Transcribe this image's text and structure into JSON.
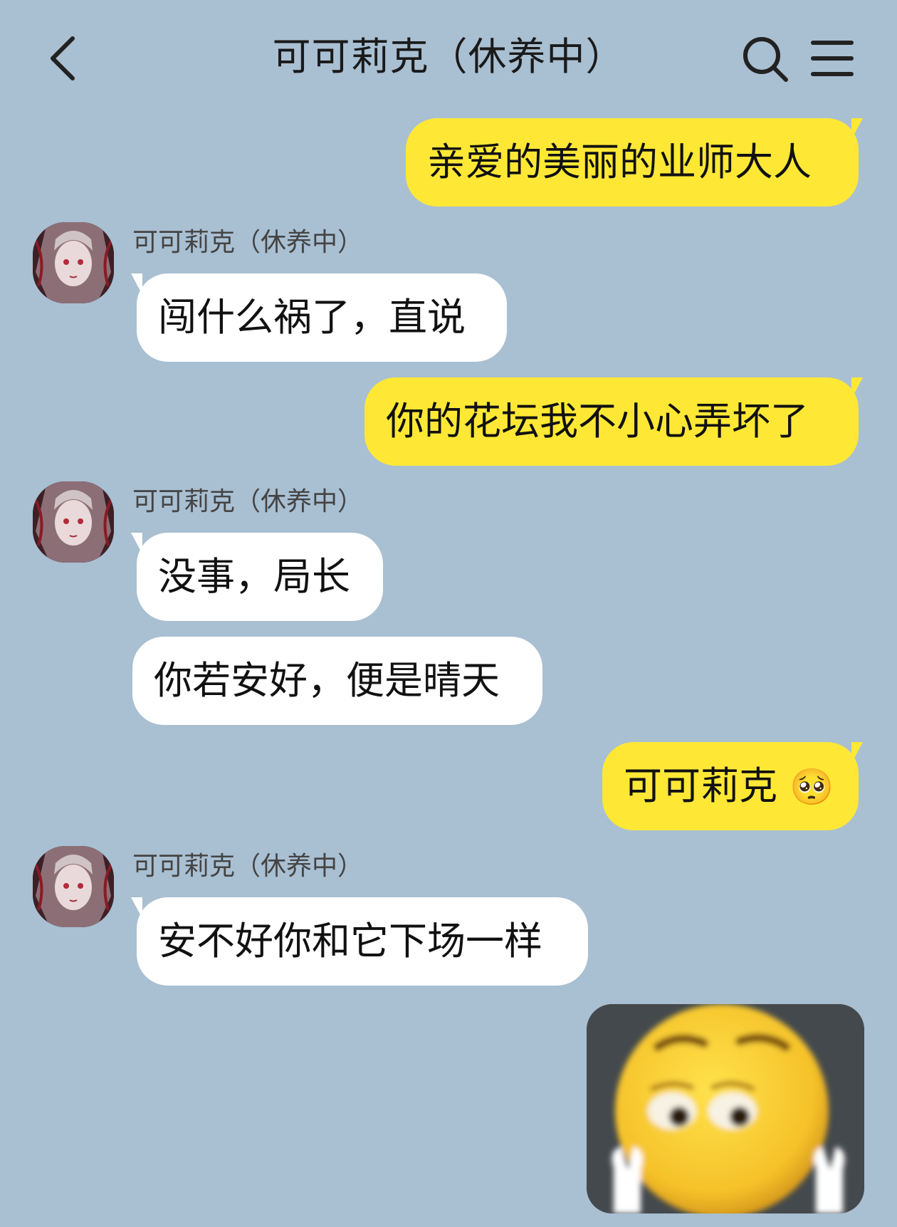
{
  "header": {
    "title": "可可莉克（休养中）"
  },
  "messages": [
    {
      "side": "out",
      "text": "亲爱的美丽的业师大人"
    },
    {
      "side": "in",
      "sender": "可可莉克（休养中）",
      "text": "闯什么祸了，直说"
    },
    {
      "side": "out",
      "text": "你的花坛我不小心弄坏了"
    },
    {
      "side": "in",
      "sender": "可可莉克（休养中）",
      "text": "没事，局长"
    },
    {
      "side": "in",
      "text": "你若安好，便是晴天"
    },
    {
      "side": "out",
      "text": "可可莉克",
      "emoji": "🥺"
    },
    {
      "side": "in",
      "sender": "可可莉克（休养中）",
      "text": "安不好你和它下场一样"
    },
    {
      "side": "out",
      "sticker": "worried-smiley-sticker"
    }
  ],
  "colors": {
    "background": "#a9bfd2",
    "outgoing_bubble": "#ffe835",
    "incoming_bubble": "#ffffff"
  }
}
